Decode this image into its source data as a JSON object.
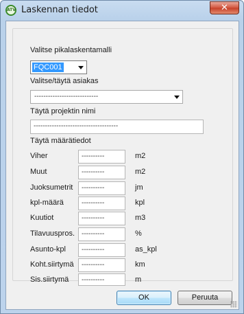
{
  "window": {
    "title": "Laskennan tiedot",
    "app_icon_text": "ATV",
    "close_glyph": "✕"
  },
  "form": {
    "model_label": "Valitse pikalaskentamalli",
    "model_value": "FQC001",
    "customer_label": "Valitse/täytä asiakas",
    "customer_value": "----------------------------",
    "project_label": "Täytä projektin nimi",
    "project_value": "-------------------------------------",
    "quantities_label": "Täytä määrätiedot",
    "rows": [
      {
        "label": "Viher",
        "value": "----------",
        "unit": "m2"
      },
      {
        "label": "Muut",
        "value": "----------",
        "unit": "m2"
      },
      {
        "label": "Juoksumetrit",
        "value": "----------",
        "unit": "jm"
      },
      {
        "label": "kpl-määrä",
        "value": "----------",
        "unit": "kpl"
      },
      {
        "label": "Kuutiot",
        "value": "----------",
        "unit": "m3"
      },
      {
        "label": "Tilavuuspros.",
        "value": "----------",
        "unit": "%"
      },
      {
        "label": "Asunto-kpl",
        "value": "----------",
        "unit": "as_kpl"
      },
      {
        "label": "Koht.siirtymä",
        "value": "----------",
        "unit": "km"
      },
      {
        "label": "Sis.siirtymä",
        "value": "----------",
        "unit": "m"
      }
    ]
  },
  "buttons": {
    "ok_label": "OK",
    "cancel_label": "Peruuta"
  },
  "colors": {
    "selection": "#3399ff",
    "title_gradient": "#c9dcf0",
    "close_button": "#c63f28"
  },
  "icons": {
    "app": "app-logo-icon",
    "close": "close-icon",
    "dropdown": "chevron-down-icon",
    "resize": "resize-grip-icon"
  }
}
